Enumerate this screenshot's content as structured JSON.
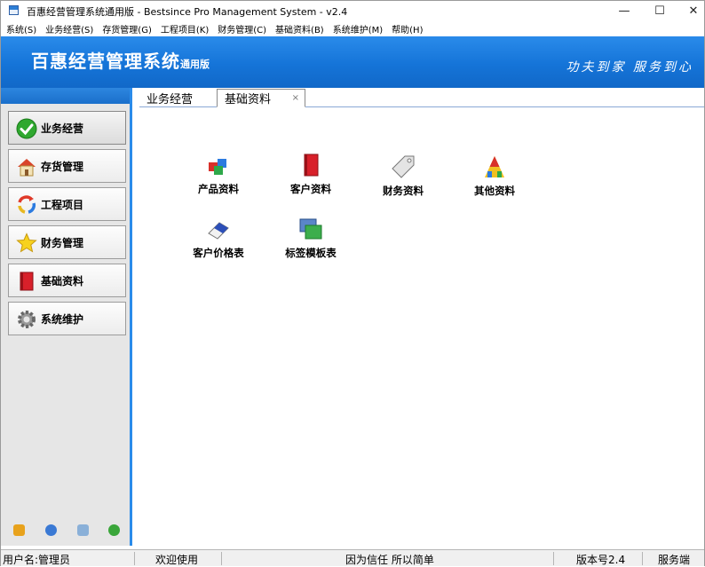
{
  "window": {
    "title": "百惠经营管理系统通用版 - Bestsince Pro Management System - v2.4",
    "controls": {
      "minimize": "—",
      "maximize": "☐",
      "close": "✕"
    }
  },
  "menu": {
    "items": [
      {
        "label": "系统(S)"
      },
      {
        "label": "业务经营(S)"
      },
      {
        "label": "存货管理(G)"
      },
      {
        "label": "工程项目(K)"
      },
      {
        "label": "财务管理(C)"
      },
      {
        "label": "基础资料(B)"
      },
      {
        "label": "系统维护(M)"
      },
      {
        "label": "帮助(H)"
      }
    ]
  },
  "banner": {
    "title": "百惠经营管理系统",
    "edition": "通用版",
    "slogan": "功夫到家 服务到心"
  },
  "sidebar": {
    "items": [
      {
        "label": "业务经营",
        "icon": "check-icon"
      },
      {
        "label": "存货管理",
        "icon": "house-icon"
      },
      {
        "label": "工程项目",
        "icon": "recycle-icon"
      },
      {
        "label": "财务管理",
        "icon": "star-icon"
      },
      {
        "label": "基础资料",
        "icon": "book-icon"
      },
      {
        "label": "系统维护",
        "icon": "gear-icon"
      }
    ],
    "tools": [
      "key-icon",
      "clock-icon",
      "search-doc-icon",
      "back-icon"
    ]
  },
  "tabs": [
    {
      "label": "业务经营"
    },
    {
      "label": "基础资料",
      "close": "×"
    }
  ],
  "modules": [
    {
      "label": "产品资料",
      "icon": "cubes-icon"
    },
    {
      "label": "客户资料",
      "icon": "red-book-icon"
    },
    {
      "label": "财务资料",
      "icon": "tag-icon"
    },
    {
      "label": "其他资料",
      "icon": "palette-icon"
    },
    {
      "label": "客户价格表",
      "icon": "eraser-icon"
    },
    {
      "label": "标签模板表",
      "icon": "windows-icon"
    }
  ],
  "status": {
    "user": "用户名:管理员",
    "welcome": "欢迎使用",
    "motto": "因为信任 所以简单",
    "version": "版本号2.4",
    "server": "服务端"
  },
  "colors": {
    "banner_blue": "#1574d8",
    "sidebar_bg": "#e6e6e6"
  }
}
